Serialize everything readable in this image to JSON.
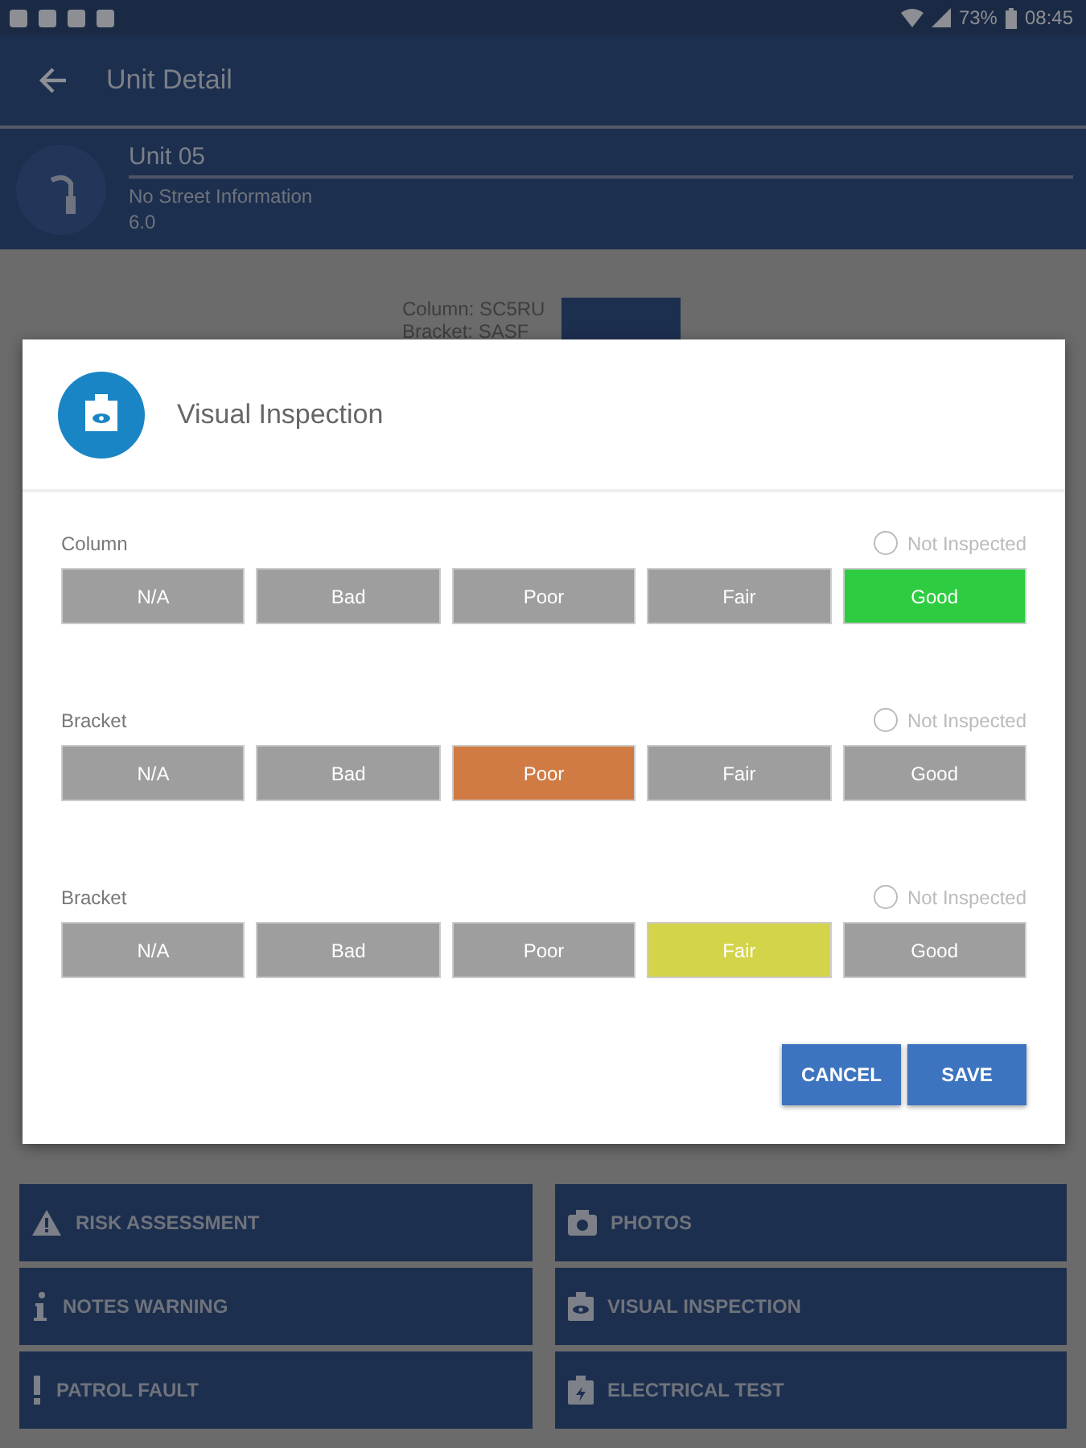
{
  "status_bar": {
    "battery": "73%",
    "time": "08:45"
  },
  "app_bar": {
    "title": "Unit Detail"
  },
  "unit": {
    "name": "Unit 05",
    "street": "No Street Information",
    "number": "6.0"
  },
  "background_info": {
    "lines": [
      "Column: SC5RU",
      "Bracket: SASF"
    ]
  },
  "dialog": {
    "title": "Visual Inspection",
    "rows": [
      {
        "label": "Column",
        "not_inspected": {
          "label": "Not Inspected",
          "checked": false
        },
        "options": [
          {
            "label": "N/A",
            "selected": false
          },
          {
            "label": "Bad",
            "selected": false
          },
          {
            "label": "Poor",
            "selected": false
          },
          {
            "label": "Fair",
            "selected": false
          },
          {
            "label": "Good",
            "selected": true,
            "color": "#2ecc40"
          }
        ]
      },
      {
        "label": "Bracket",
        "not_inspected": {
          "label": "Not Inspected",
          "checked": false
        },
        "options": [
          {
            "label": "N/A",
            "selected": false
          },
          {
            "label": "Bad",
            "selected": false
          },
          {
            "label": "Poor",
            "selected": true,
            "color": "#d07b44"
          },
          {
            "label": "Fair",
            "selected": false
          },
          {
            "label": "Good",
            "selected": false
          }
        ]
      },
      {
        "label": "Bracket",
        "not_inspected": {
          "label": "Not Inspected",
          "checked": false
        },
        "options": [
          {
            "label": "N/A",
            "selected": false
          },
          {
            "label": "Bad",
            "selected": false
          },
          {
            "label": "Poor",
            "selected": false
          },
          {
            "label": "Fair",
            "selected": true,
            "color": "#d4d44a"
          },
          {
            "label": "Good",
            "selected": false
          }
        ]
      }
    ],
    "buttons": [
      "CANCEL",
      "SAVE"
    ]
  },
  "tiles": [
    {
      "kind": "warning",
      "label": "RISK ASSESSMENT"
    },
    {
      "kind": "camera",
      "label": "PHOTOS"
    },
    {
      "kind": "info",
      "label": "NOTES WARNING"
    },
    {
      "kind": "clipboard-eye",
      "label": "VISUAL INSPECTION"
    },
    {
      "kind": "exclaim",
      "label": "PATROL FAULT"
    },
    {
      "kind": "clipboard-bolt",
      "label": "ELECTRICAL TEST"
    }
  ]
}
